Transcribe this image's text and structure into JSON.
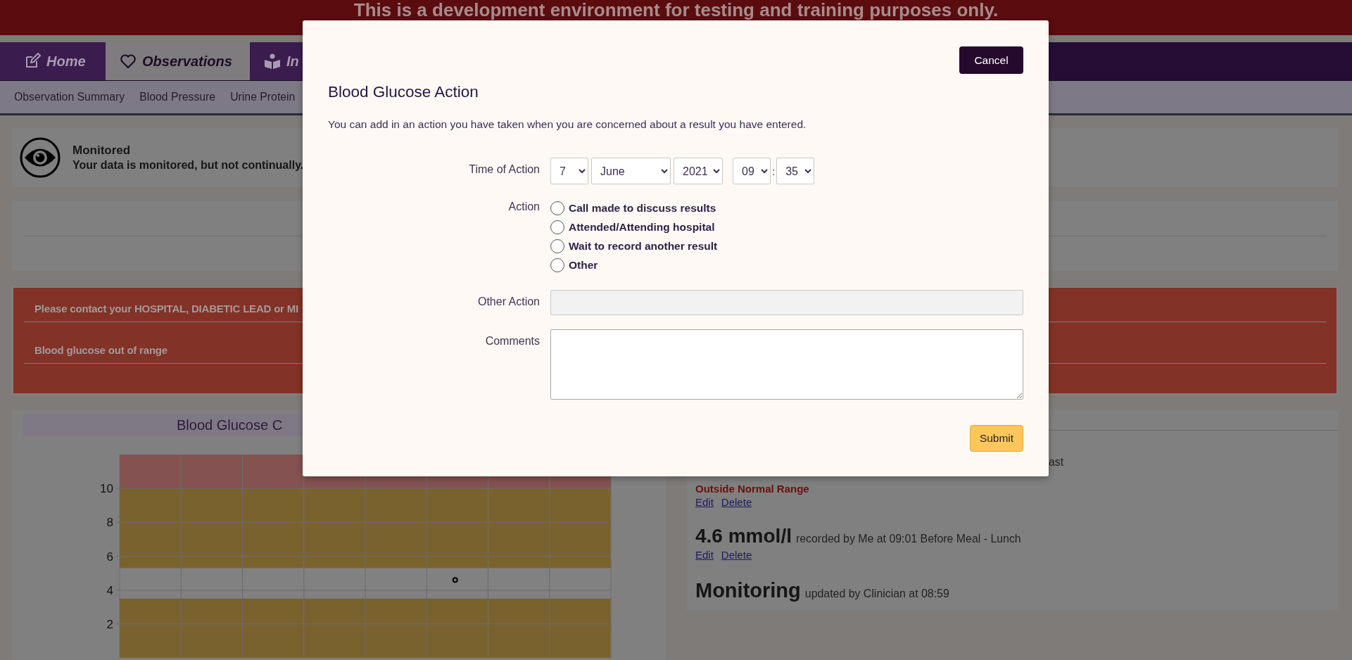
{
  "banner": {
    "text": "This is a development environment for testing and training purposes only."
  },
  "nav": {
    "tabs": [
      {
        "label": "Home",
        "selected": false
      },
      {
        "label": "Observations",
        "selected": true
      },
      {
        "label": "In",
        "selected": false
      }
    ]
  },
  "subnav": {
    "items": [
      "Observation Summary",
      "Blood Pressure",
      "Urine Protein"
    ]
  },
  "status_card": {
    "title": "Monitored",
    "text": "Your data is monitored, but not continually."
  },
  "alert": {
    "messages": [
      "Please contact your HOSPITAL, DIABETIC LEAD or MI",
      "Blood glucose out of range"
    ]
  },
  "chart_panel": {
    "title": "Blood Glucose C",
    "y_axis_labels": [
      "10",
      "8",
      "6",
      "4",
      "2"
    ]
  },
  "readings_panel": {
    "entries": [
      {
        "kind": "reading",
        "text": "ast",
        "status": "Outside Normal Range",
        "links": [
          "Edit",
          "Delete"
        ]
      },
      {
        "kind": "reading",
        "value": "4.6 mmol/l",
        "text": "recorded by Me at 09:01 Before Meal - Lunch",
        "links": [
          "Edit",
          "Delete"
        ]
      },
      {
        "kind": "status",
        "value": "Monitoring",
        "text": "updated by Clinician at 08:59"
      }
    ]
  },
  "modal": {
    "cancel": "Cancel",
    "title": "Blood Glucose Action",
    "description": "You can add in an action you have taken when you are concerned about a result you have entered.",
    "time_label": "Time of Action",
    "day": "7",
    "month": "June",
    "year": "2021",
    "hour": "09",
    "separator": ":",
    "minute": "35",
    "action_label": "Action",
    "actions": [
      {
        "label": "Call made to discuss results",
        "selected": false
      },
      {
        "label": "Attended/Attending hospital",
        "selected": false
      },
      {
        "label": "Wait to record another result",
        "selected": false
      },
      {
        "label": "Other",
        "selected": false
      }
    ],
    "other_label": "Other Action",
    "other_disabled": true,
    "comments_label": "Comments",
    "submit": "Submit"
  }
}
